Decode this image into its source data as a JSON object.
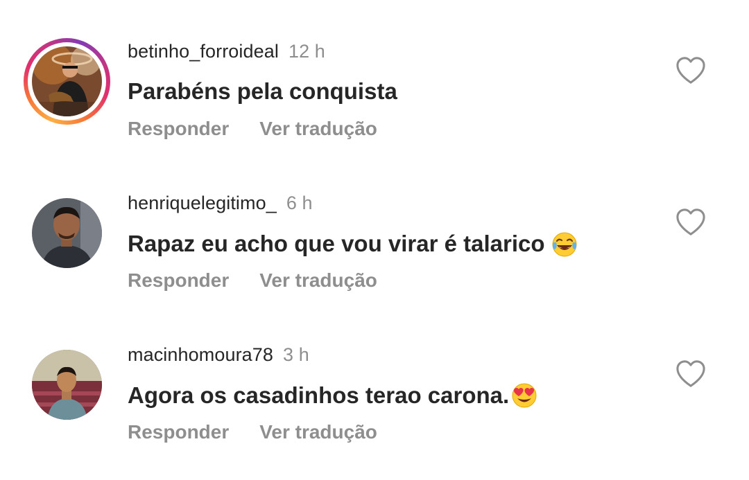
{
  "comments": [
    {
      "username": "betinho_forroideal",
      "time": "12 h",
      "text": "Parabéns pela conquista",
      "emoji": "",
      "reply_label": "Responder",
      "translate_label": "Ver tradução",
      "has_story_ring": true
    },
    {
      "username": "henriquelegitimo_",
      "time": "6 h",
      "text": "Rapaz eu acho que vou virar é talarico",
      "emoji": "face-with-tears-of-joy",
      "reply_label": "Responder",
      "translate_label": "Ver tradução",
      "has_story_ring": false
    },
    {
      "username": "macinhomoura78",
      "time": "3 h",
      "text": "Agora os casadinhos terao carona.",
      "emoji": "smiling-face-with-heart-eyes",
      "reply_label": "Responder",
      "translate_label": "Ver tradução",
      "has_story_ring": false
    }
  ],
  "colors": {
    "text_primary": "#262626",
    "text_secondary": "#8e8e8e",
    "background": "#ffffff"
  }
}
